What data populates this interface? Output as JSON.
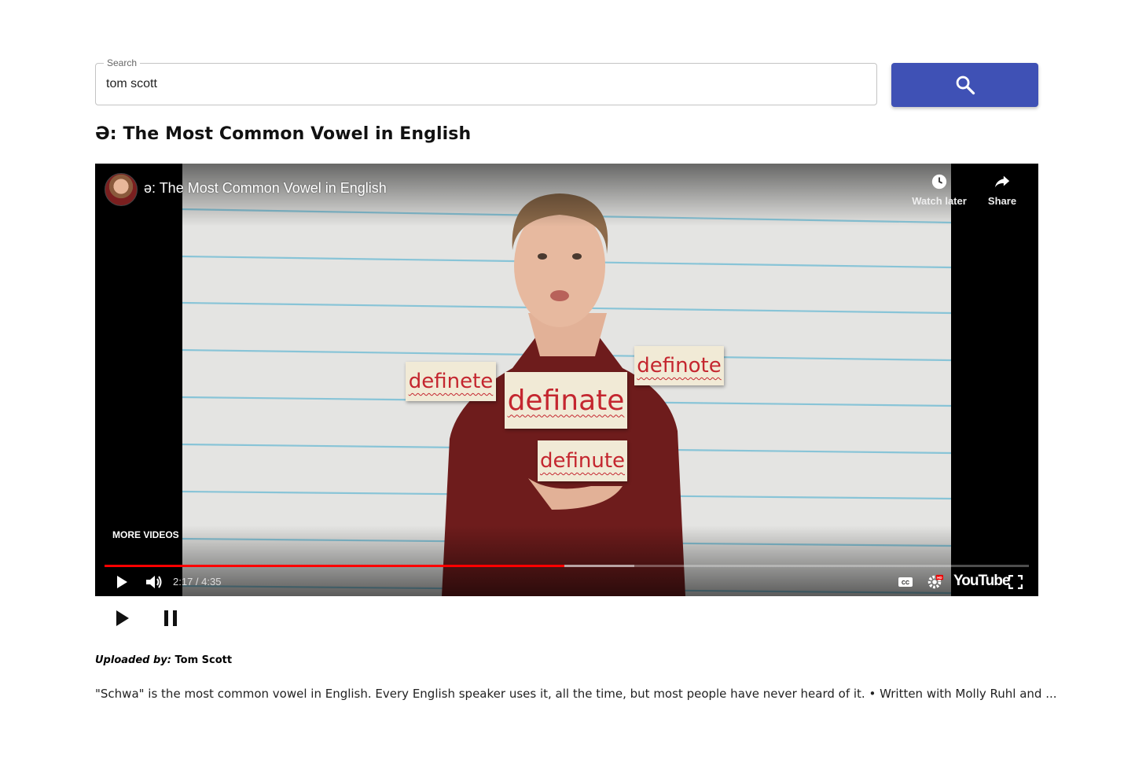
{
  "search": {
    "label": "Search",
    "value": "tom scott",
    "button_icon": "search-icon",
    "button_color": "#3f51b5"
  },
  "video": {
    "title": "Ə: The Most Common Vowel in English",
    "player_title": "ə: The Most Common Vowel in English",
    "watch_later_label": "Watch later",
    "share_label": "Share",
    "more_videos_label": "MORE VIDEOS",
    "time": "2:17 / 4:35",
    "progress_played": 0.4977,
    "progress_buffered": 0.573,
    "brand": "YouTube",
    "progress_color": "#ff0000",
    "cards": [
      "definete",
      "definate",
      "definote",
      "definute"
    ],
    "card_text_color": "#c4262f"
  },
  "playback": {
    "play_icon": "play-icon",
    "pause_icon": "pause-icon"
  },
  "meta": {
    "uploaded_by_label": "Uploaded by:",
    "uploader": "Tom Scott",
    "description": "\"Schwa\" is the most common vowel in English. Every English speaker uses it, all the time, but most people have never heard of it. • Written with Molly Ruhl and ..."
  }
}
